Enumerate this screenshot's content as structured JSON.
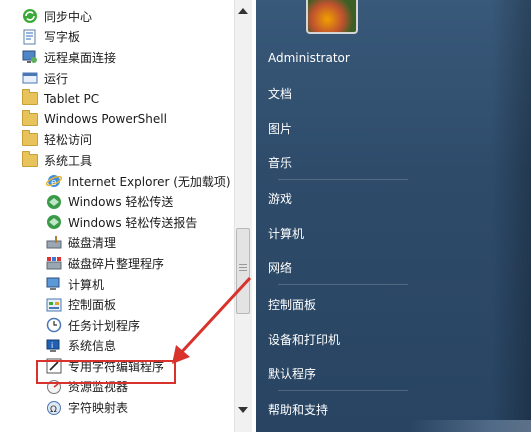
{
  "programs": [
    {
      "label": "同步中心",
      "icon": "sync-center-icon",
      "sub": false
    },
    {
      "label": "写字板",
      "icon": "wordpad-icon",
      "sub": false
    },
    {
      "label": "远程桌面连接",
      "icon": "remote-desktop-icon",
      "sub": false
    },
    {
      "label": "运行",
      "icon": "run-icon",
      "sub": false
    },
    {
      "label": "Tablet PC",
      "icon": "folder-icon",
      "sub": false
    },
    {
      "label": "Windows PowerShell",
      "icon": "folder-icon",
      "sub": false
    },
    {
      "label": "轻松访问",
      "icon": "folder-icon",
      "sub": false
    },
    {
      "label": "系统工具",
      "icon": "folder-icon",
      "sub": false
    },
    {
      "label": "Internet Explorer (无加载项)",
      "icon": "internet-explorer-icon",
      "sub": true
    },
    {
      "label": "Windows 轻松传送",
      "icon": "easy-transfer-icon",
      "sub": true
    },
    {
      "label": "Windows 轻松传送报告",
      "icon": "easy-transfer-report-icon",
      "sub": true
    },
    {
      "label": "磁盘清理",
      "icon": "disk-cleanup-icon",
      "sub": true
    },
    {
      "label": "磁盘碎片整理程序",
      "icon": "disk-defrag-icon",
      "sub": true
    },
    {
      "label": "计算机",
      "icon": "computer-icon",
      "sub": true
    },
    {
      "label": "控制面板",
      "icon": "control-panel-icon",
      "sub": true
    },
    {
      "label": "任务计划程序",
      "icon": "task-scheduler-icon",
      "sub": true
    },
    {
      "label": "系统信息",
      "icon": "system-info-icon",
      "sub": true
    },
    {
      "label": "专用字符编辑程序",
      "icon": "private-char-editor-icon",
      "sub": true
    },
    {
      "label": "资源监视器",
      "icon": "resource-monitor-icon",
      "sub": true
    },
    {
      "label": "字符映射表",
      "icon": "character-map-icon",
      "sub": true
    }
  ],
  "right_menu": {
    "user": "Administrator",
    "documents": "文档",
    "pictures": "图片",
    "music": "音乐",
    "games": "游戏",
    "computer": "计算机",
    "network": "网络",
    "control_panel": "控制面板",
    "devices_printers": "设备和打印机",
    "default_programs": "默认程序",
    "help_support": "帮助和支持"
  },
  "colors": {
    "highlight_border": "#d9312b",
    "annotation_arrow": "#d9312b",
    "right_pane": "#2e4b6a"
  }
}
